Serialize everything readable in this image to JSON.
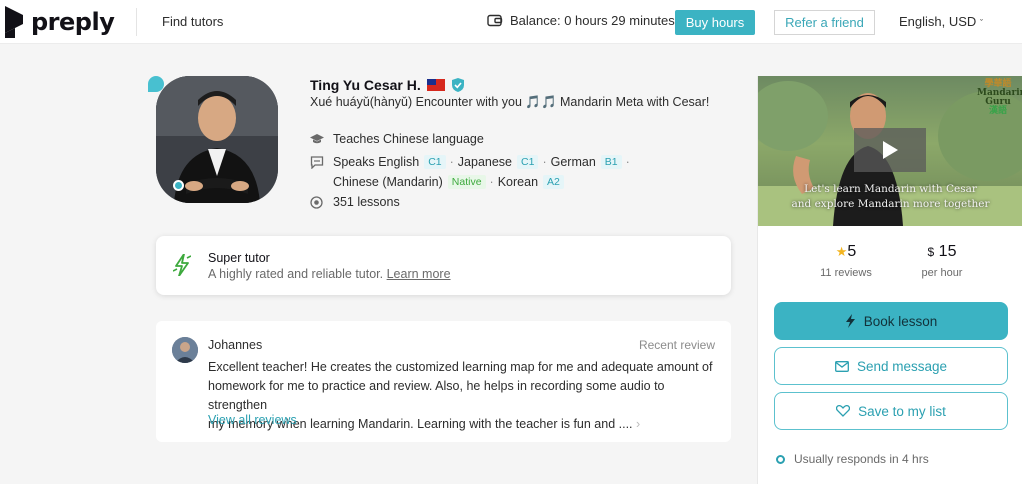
{
  "header": {
    "logo_text": "preply",
    "find_tutors": "Find tutors",
    "balance": "Balance: 0 hours 29 minutes",
    "buy_hours": "Buy hours",
    "refer_friend": "Refer a friend",
    "language_currency": "English, USD"
  },
  "tutor": {
    "name": "Ting Yu Cesar H.",
    "headline": "Xué huáyǔ(hànyǔ) Encounter with you 🎵🎵 Mandarin Meta with Cesar!",
    "teaches": "Teaches Chinese language",
    "speaks_label": "Speaks",
    "languages": [
      {
        "name": "English",
        "level": "C1"
      },
      {
        "name": "Japanese",
        "level": "C1"
      },
      {
        "name": "German",
        "level": "B1"
      },
      {
        "name": "Chinese (Mandarin)",
        "level": "Native"
      },
      {
        "name": "Korean",
        "level": "A2"
      }
    ],
    "lessons": "351 lessons"
  },
  "super_tutor": {
    "title": "Super tutor",
    "subtitle": "A highly rated and reliable tutor.",
    "link": "Learn more"
  },
  "review": {
    "author": "Johannes",
    "tag": "Recent review",
    "line1": "Excellent teacher! He creates the customized learning map for me and adequate amount of",
    "line2": "homework for me to practice and review. Also, he helps in recording some audio to strengthen",
    "line3": "my memory when learning Mandarin. Learning with the teacher is fun and ....",
    "more": "›",
    "view_all": "View all reviews"
  },
  "sidebar": {
    "video_logo_line1": "學華語",
    "video_logo_line2": "Mandarin",
    "video_logo_line3": "Guru",
    "video_logo_line4": "漢語",
    "caption1": "Let's learn Mandarin with Cesar",
    "caption2": "and explore Mandarin more together",
    "rating": "5",
    "reviews": "11 reviews",
    "price_symbol": "$",
    "price": "15",
    "per_hour": "per hour",
    "book": "Book lesson",
    "message": "Send message",
    "save": "Save to my list",
    "responds": "Usually responds in 4 hrs"
  },
  "colors": {
    "accent": "#3bb3c3",
    "accent_text": "#2ba0b1",
    "native": "#3da93d",
    "star": "#f3b521"
  }
}
